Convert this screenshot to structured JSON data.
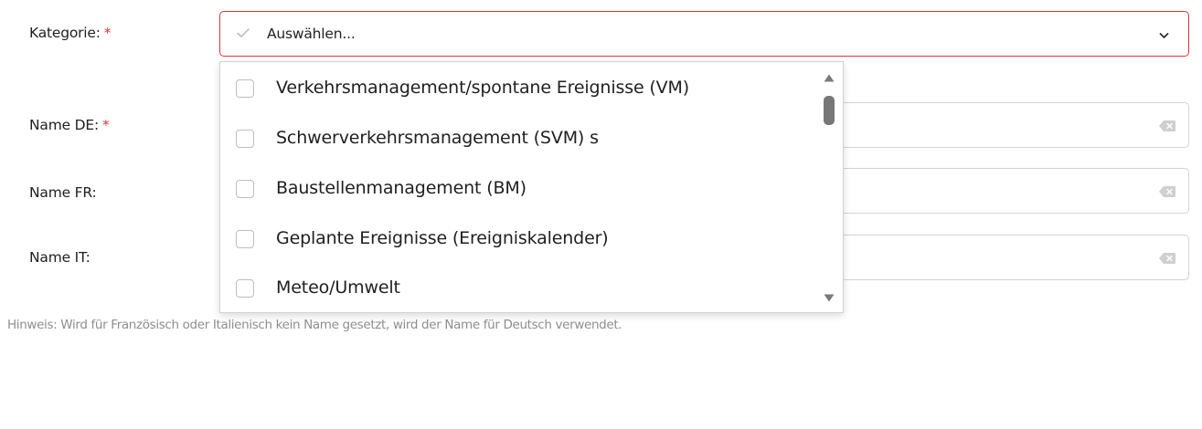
{
  "form": {
    "kategorie": {
      "label": "Kategorie:",
      "required_mark": "*",
      "placeholder": "Auswählen...",
      "options": [
        {
          "label": "Verkehrsmanagement/spontane Ereignisse (VM)",
          "checked": false
        },
        {
          "label": "Schwerverkehrsmanagement (SVM) s",
          "checked": false
        },
        {
          "label": "Baustellenmanagement (BM)",
          "checked": false
        },
        {
          "label": "Geplante Ereignisse (Ereigniskalender)",
          "checked": false
        },
        {
          "label": "Meteo/Umwelt",
          "checked": false
        }
      ]
    },
    "name_de": {
      "label": "Name DE:",
      "required_mark": "*",
      "value": ""
    },
    "name_fr": {
      "label": "Name FR:",
      "value": ""
    },
    "name_it": {
      "label": "Name IT:",
      "value": ""
    },
    "hint": "Hinweis: Wird für Französisch oder Italienisch kein Name gesetzt, wird der Name für Deutsch verwendet."
  },
  "colors": {
    "required": "#d63a3a",
    "error_border": "#e0353a",
    "hint": "#8e8e8e",
    "field_border": "#d3d3d3"
  },
  "icons": {
    "select_prefix": "check-icon",
    "select_suffix": "chevron-down-icon",
    "field_clear": "backspace-clear-icon"
  }
}
